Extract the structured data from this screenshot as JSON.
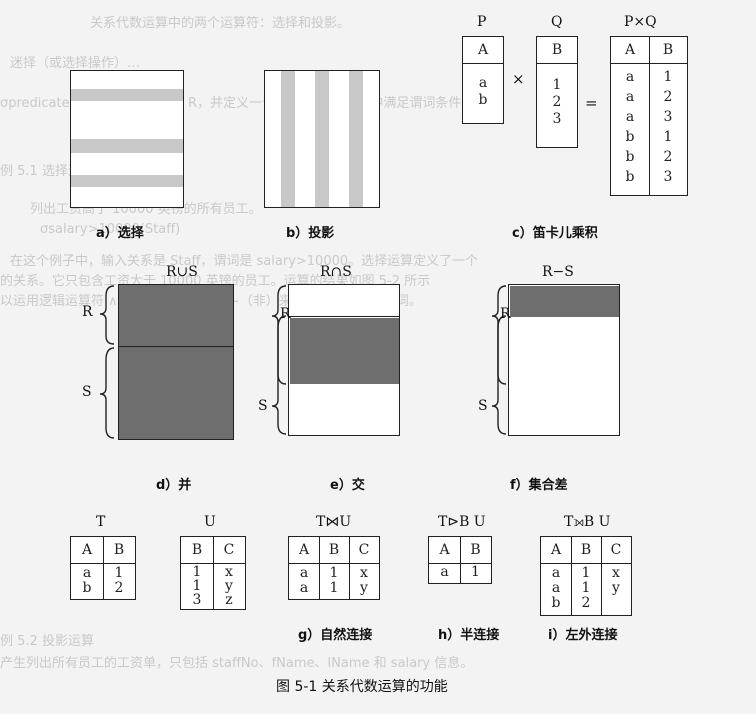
{
  "figure_caption": "图 5-1   关系代数运算的功能",
  "panels": {
    "selection": {
      "caption": "a）选择"
    },
    "projection": {
      "caption": "b）投影"
    },
    "product": {
      "caption": "c）笛卡儿乘积",
      "p_title": "P",
      "q_title": "Q",
      "pq_title": "P×Q",
      "p_header": "A",
      "p_values": [
        "a",
        "b"
      ],
      "q_header": "B",
      "q_values": [
        "1",
        "2",
        "3"
      ],
      "times": "×",
      "equals": "=",
      "pq_headers": [
        "A",
        "B"
      ],
      "pq_col_a": [
        "a",
        "a",
        "a",
        "b",
        "b",
        "b"
      ],
      "pq_col_b": [
        "1",
        "2",
        "3",
        "1",
        "2",
        "3"
      ]
    },
    "union": {
      "caption": "d）并",
      "title": "R∪S",
      "r": "R",
      "s": "S"
    },
    "intersection": {
      "caption": "e）交",
      "title": "R∩S",
      "r": "R",
      "s": "S"
    },
    "difference": {
      "caption": "f）集合差",
      "title": "R−S",
      "r": "R",
      "s": "S"
    },
    "t_table": {
      "title": "T",
      "headers": [
        "A",
        "B"
      ],
      "col_a": [
        "a",
        "b"
      ],
      "col_b": [
        "1",
        "2"
      ]
    },
    "u_table": {
      "title": "U",
      "headers": [
        "B",
        "C"
      ],
      "col_b": [
        "1",
        "1",
        "3"
      ],
      "col_c": [
        "x",
        "y",
        "z"
      ]
    },
    "natural_join": {
      "caption": "g）自然连接",
      "title": "T⋈U",
      "headers": [
        "A",
        "B",
        "C"
      ],
      "col_a": [
        "a",
        "a"
      ],
      "col_b": [
        "1",
        "1"
      ],
      "col_c": [
        "x",
        "y"
      ]
    },
    "semi_join": {
      "caption": "h）半连接",
      "title": "T⊳B U",
      "headers": [
        "A",
        "B"
      ],
      "col_a": [
        "a"
      ],
      "col_b": [
        "1"
      ]
    },
    "left_outer_join": {
      "caption": "i）左外连接",
      "title": "T⟕B U",
      "headers": [
        "A",
        "B",
        "C"
      ],
      "col_a": [
        "a",
        "a",
        "b"
      ],
      "col_b": [
        "1",
        "1",
        "2"
      ],
      "col_c": [
        "x",
        "y",
        ""
      ]
    }
  },
  "background_lines": [
    "关系代数运算中的两个运算符：选择和投影。",
    "迷择（或选择操作）…",
    "σpredicate(R)  作用于一个关系 R，并定义一个新关系，它由 R 中满足谓词条件",
    "例 5.1  选择运算",
    "列出工资高于 10000 英镑的所有员工。",
    "σsalary>10000(Staff)",
    "在这个例子中，输入关系是 Staff，谓词是 salary>10000。选择运算定义了一个",
    "的关系。它只包含工资大于 10000 英镑的员工。运算的结果如图 5-2 所示",
    "以运用逻辑运算符 ∧（与）、∨（或）和 ~（非）来构成更为复杂的谓词。",
    "例 5.2  投影运算",
    "产生列出所有员工的工资单，只包括 staffNo、fName、lName 和 salary 信息。"
  ]
}
